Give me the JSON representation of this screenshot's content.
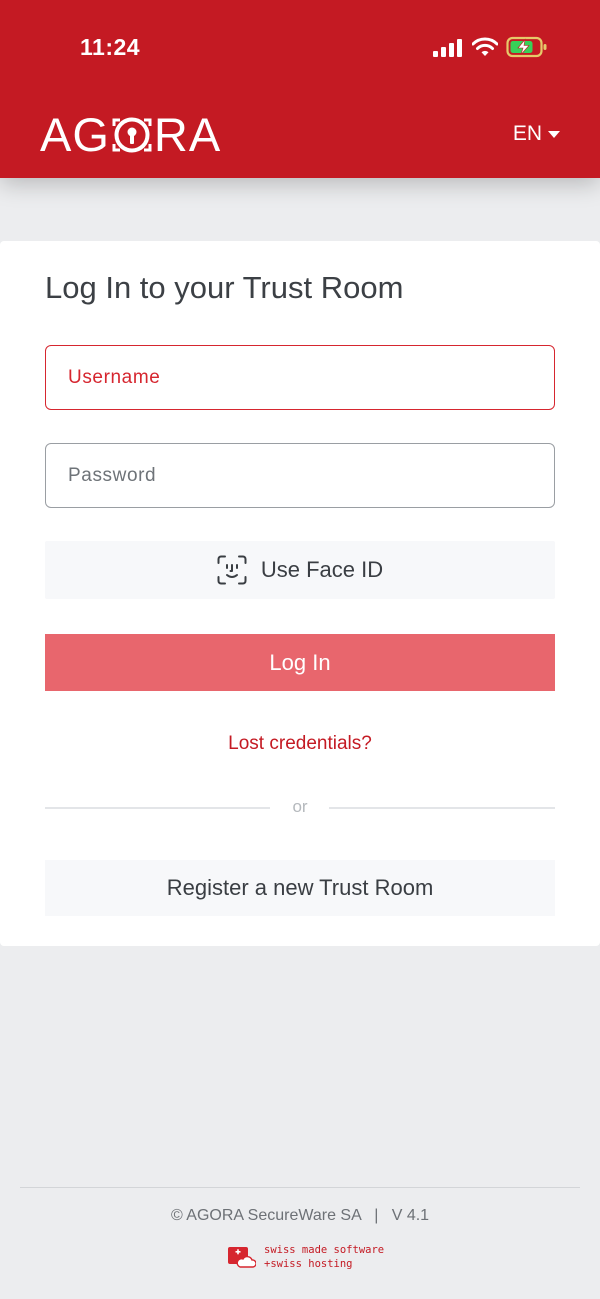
{
  "status_bar": {
    "time": "11:24",
    "icons": [
      "signal-icon",
      "wifi-icon",
      "battery-charging-icon"
    ]
  },
  "header": {
    "logo_prefix": "AG",
    "logo_suffix": "RA",
    "language": "EN"
  },
  "login": {
    "title": "Log In to your Trust Room",
    "username_placeholder": "Username",
    "password_placeholder": "Password",
    "face_id_label": "Use Face ID",
    "login_label": "Log In",
    "lost_credentials": "Lost credentials?",
    "or_label": "or",
    "register_label": "Register a new Trust Room"
  },
  "footer": {
    "copyright": "© AGORA SecureWare SA   |   V 4.1",
    "swiss_line1": "swiss made software",
    "swiss_line2": "+swiss hosting"
  },
  "colors": {
    "brand_red": "#c41a23",
    "login_button": "#e8666d",
    "background": "#ecedef"
  }
}
